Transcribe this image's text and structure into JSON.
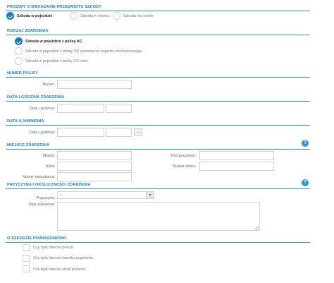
{
  "damage_subject": {
    "title": "PROSIMY O WSKAZANIE PRZEDMIOTU SZKODY",
    "options": [
      {
        "label": "Szkoda w pojeździe",
        "checked": true
      },
      {
        "label": "Szkoda w mieniu",
        "checked": false
      },
      {
        "label": "Szkoda na osobie",
        "checked": false
      }
    ]
  },
  "event_type": {
    "title": "RODZAJ ZDARZENIA",
    "options": [
      {
        "label": "Szkoda w pojeździe z polisy AC",
        "checked": true
      },
      {
        "label": "Szkoda w pojeździe z polisy OC posiadacza pojazdu mechanicznego",
        "checked": false
      },
      {
        "label": "Szkoda w pojeździe z polisy OC inne",
        "checked": false
      }
    ]
  },
  "policy_number": {
    "title": "NUMER POLISY",
    "label": "Numer:",
    "value": ""
  },
  "event_datetime": {
    "title": "DATA I GODZINA ZDARZENIA",
    "label": "Data i godzina:",
    "date": "",
    "time": ""
  },
  "disclosure_date": {
    "title": "DATA UJAWNIENIA",
    "label": "Data i godzina:",
    "date": "",
    "time": "",
    "button_label": "…"
  },
  "event_place": {
    "title": "MIEJSCE ZDARZENIA",
    "help_label": "?",
    "city_label": "Miasto:",
    "street_label": "Ulica:",
    "apartment_label": "Numer mieszkania:",
    "postal_label": "Kod pocztowy:",
    "house_label": "Numer domu:"
  },
  "cause": {
    "title": "PRZYCZYNA I OKOLICZNOŚCI ZDARZENIA",
    "help_label": "?",
    "cause_label": "Przyczyna:",
    "cause_value": "--",
    "description_label": "Opis zdarzenia:"
  },
  "notified": {
    "title": "O SZKODZIE POWIADOMIONO",
    "items": [
      {
        "label": "Czy była obecna policja",
        "checked": false
      },
      {
        "label": "Czy była obecna karetka pogotowia",
        "checked": false
      },
      {
        "label": "Czy była obecna straż pożarna",
        "checked": false
      }
    ]
  },
  "colors": {
    "accent": "#1a7cc7",
    "section_line": "#3a90d6",
    "help_icon": "#2f95dc"
  }
}
